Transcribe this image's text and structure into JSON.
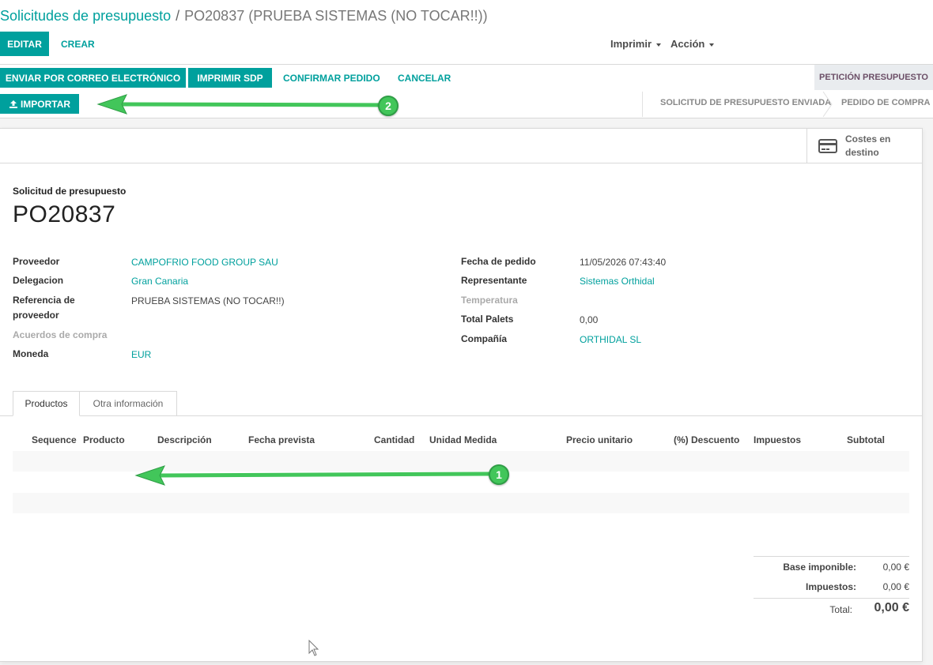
{
  "breadcrumb": {
    "parent": "Solicitudes de presupuesto",
    "separator": "/",
    "current": "PO20837 (PRUEBA SISTEMAS (NO TOCAR!!))"
  },
  "control": {
    "edit": "EDITAR",
    "create": "CREAR",
    "print": "Imprimir",
    "action": "Acción"
  },
  "header_buttons": {
    "send_email": "ENVIAR POR CORREO ELECTRÓNICO",
    "print_rfq": "IMPRIMIR SDP",
    "confirm": "CONFIRMAR PEDIDO",
    "cancel": "CANCELAR",
    "import": "IMPORTAR"
  },
  "status": {
    "active": "PETICIÓN PRESUPUESTO",
    "step_sent": "SOLICITUD DE PRESUPUESTO ENVIADA",
    "step_po": "PEDIDO DE COMPRA"
  },
  "stat_button": {
    "label": "Costes en destino",
    "icon": "credit-card-icon"
  },
  "form": {
    "title_label": "Solicitud de presupuesto",
    "name": "PO20837",
    "left": {
      "proveedor_label": "Proveedor",
      "proveedor": "CAMPOFRIO FOOD GROUP SAU",
      "delegacion_label": "Delegacion",
      "delegacion": "Gran Canaria",
      "referencia_label": "Referencia de proveedor",
      "referencia": "PRUEBA SISTEMAS (NO TOCAR!!)",
      "acuerdos_label": "Acuerdos de compra",
      "moneda_label": "Moneda",
      "moneda": "EUR"
    },
    "right": {
      "fecha_label": "Fecha de pedido",
      "fecha": "11/05/2026 07:43:40",
      "representante_label": "Representante",
      "representante": "Sistemas Orthidal",
      "temperatura_label": "Temperatura",
      "palets_label": "Total Palets",
      "palets": "0,00",
      "compania_label": "Compañía",
      "compania": "ORTHIDAL SL"
    }
  },
  "tabs": {
    "products": "Productos",
    "other": "Otra información"
  },
  "table": {
    "columns": [
      "Sequence",
      "Producto",
      "Descripción",
      "Fecha prevista",
      "Cantidad",
      "Unidad Medida",
      "Precio unitario",
      "(%) Descuento",
      "Impuestos",
      "Subtotal"
    ]
  },
  "totals": {
    "base_label": "Base imponible:",
    "base": "0,00 €",
    "taxes_label": "Impuestos:",
    "taxes": "0,00 €",
    "total_label": "Total:",
    "total": "0,00 €"
  },
  "annotations": {
    "badge1": "1",
    "badge2": "2",
    "color": "#42c65a"
  },
  "colors": {
    "primary": "#00a09d",
    "status_text": "#6c4f67"
  }
}
